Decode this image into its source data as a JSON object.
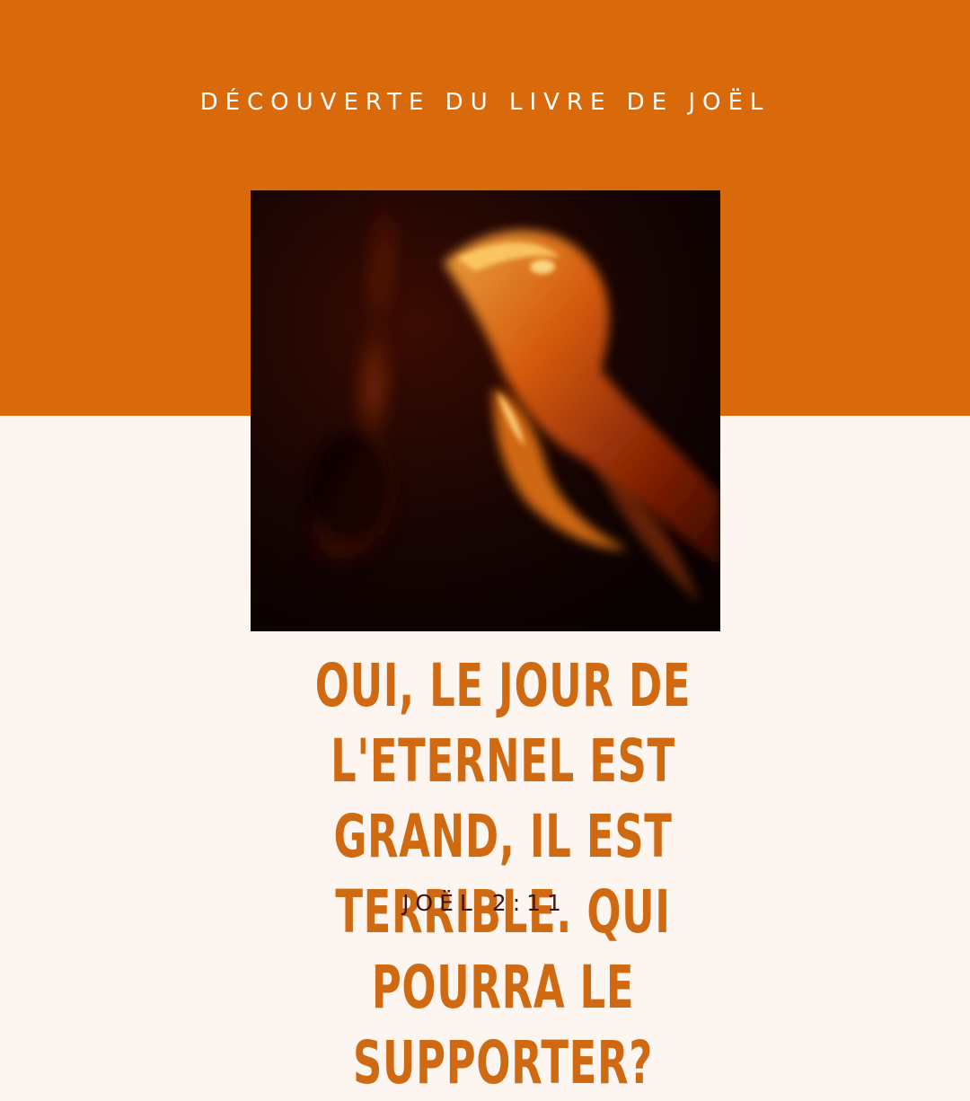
{
  "header": {
    "series_title": "DÉCOUVERTE DU LIVRE DE JOËL"
  },
  "image": {
    "subject": "flame"
  },
  "verse": {
    "quote": "OUI, LE JOUR DE L'ETERNEL EST GRAND, IL EST TERRIBLE. QUI POURRA LE SUPPORTER?",
    "reference": "JOËL 2:11"
  },
  "colors": {
    "top_band": "#d96a0b",
    "background": "#fdf5ef",
    "quote_text": "#cf6a12",
    "reference_text": "#3a1616",
    "title_text": "#ffffff"
  }
}
